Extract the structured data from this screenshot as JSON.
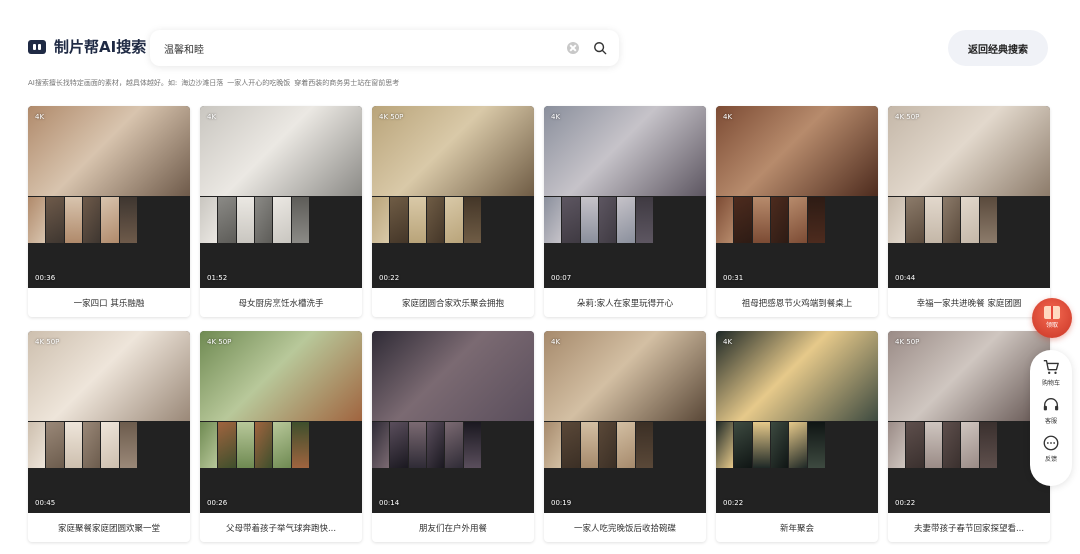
{
  "header": {
    "logo_text": "制片帮AI搜索",
    "search_value": "温馨和睦",
    "classic_label": "返回经典搜索"
  },
  "hint": {
    "intro": "AI搜索擅长找特定画面的素材，越具体越好。如:",
    "examples": [
      "海边沙滩日落",
      "一家人开心的吃晚饭",
      "穿着西装的商务男士站在窗前思考"
    ]
  },
  "cards": [
    {
      "quality": "4K",
      "duration": "00:36",
      "caption": "一家四口 其乐融融",
      "palette": [
        "#b08a6b",
        "#6e5a4a",
        "#d8c4ae",
        "#3e3630"
      ]
    },
    {
      "quality": "4K",
      "duration": "01:52",
      "caption": "母女厨房烹饪水槽洗手",
      "palette": [
        "#c9c6c0",
        "#8b8a86",
        "#ebe8e3",
        "#5d5c58"
      ]
    },
    {
      "quality": "4K 50P",
      "duration": "00:22",
      "caption": "家庭团圆合家欢乐聚会拥抱",
      "palette": [
        "#b9a47a",
        "#6f5c45",
        "#d9c9a8",
        "#443628"
      ]
    },
    {
      "quality": "4K",
      "duration": "00:07",
      "caption": "朵莉:家人在家里玩得开心",
      "palette": [
        "#8a8f9c",
        "#5d5661",
        "#c6c3c9",
        "#3f3a42"
      ]
    },
    {
      "quality": "4K",
      "duration": "00:31",
      "caption": "祖母把感恩节火鸡端到餐桌上",
      "palette": [
        "#7c4b34",
        "#4d2b1e",
        "#b78b6c",
        "#2d1b14"
      ]
    },
    {
      "quality": "4K 50P",
      "duration": "00:44",
      "caption": "幸福一家共进晚餐 家庭团圆",
      "palette": [
        "#c4b7a8",
        "#8c7b6a",
        "#e2d8cc",
        "#5a4a3c"
      ]
    },
    {
      "quality": "4K 50P",
      "duration": "00:45",
      "caption": "家庭聚餐家庭团圆欢聚一堂",
      "palette": [
        "#cdbfae",
        "#9a8878",
        "#eee5da",
        "#6c5c4d"
      ]
    },
    {
      "quality": "4K 50P",
      "duration": "00:26",
      "caption": "父母带着孩子举气球奔跑快...",
      "palette": [
        "#6f8a52",
        "#a0643f",
        "#b8c89a",
        "#3e4f2c"
      ]
    },
    {
      "quality": "",
      "duration": "00:14",
      "caption": "朋友们在户外用餐",
      "palette": [
        "#2f2b36",
        "#5a4e5c",
        "#7b6a72",
        "#1a1820"
      ]
    },
    {
      "quality": "4K",
      "duration": "00:19",
      "caption": "一家人吃完晚饭后收拾碗碟",
      "palette": [
        "#a68a6c",
        "#5a4838",
        "#d3bfa3",
        "#3b2f25"
      ]
    },
    {
      "quality": "4K",
      "duration": "00:22",
      "caption": "新年聚会",
      "palette": [
        "#1e2826",
        "#3d4a40",
        "#e6c98a",
        "#0f1514"
      ]
    },
    {
      "quality": "4K 50P",
      "duration": "00:22",
      "caption": "夫妻带孩子春节回家探望看...",
      "palette": [
        "#9a8b86",
        "#5e4f4c",
        "#cfc6c0",
        "#3a302e"
      ]
    }
  ],
  "floating": {
    "gift_label": "领取",
    "cart_label": "购物车",
    "service_label": "客服",
    "feedback_label": "反馈"
  }
}
